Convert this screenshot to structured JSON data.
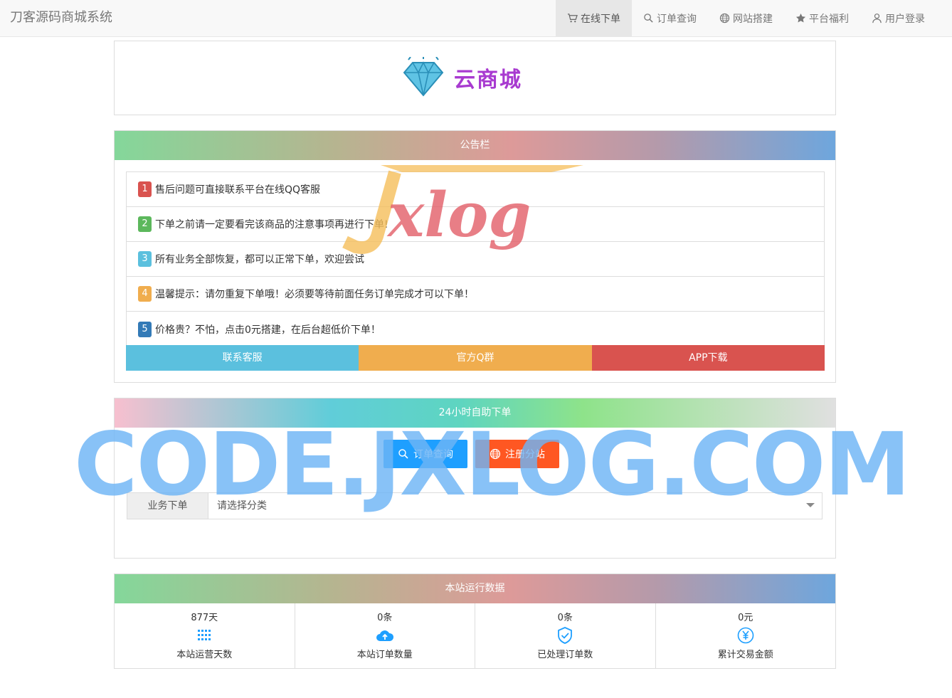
{
  "navbar": {
    "brand": "刀客源码商城系统",
    "items": [
      {
        "label": "在线下单",
        "icon": "cart-icon",
        "active": true
      },
      {
        "label": "订单查询",
        "icon": "search-icon"
      },
      {
        "label": "网站搭建",
        "icon": "globe-icon"
      },
      {
        "label": "平台福利",
        "icon": "star-icon"
      },
      {
        "label": "用户登录",
        "icon": "user-icon"
      }
    ]
  },
  "logo": {
    "text": "云商城",
    "icon": "diamond-icon"
  },
  "notice": {
    "title": "公告栏",
    "items": [
      {
        "num": "1",
        "text": "售后问题可直接联系平台在线QQ客服",
        "color": "#d9534f"
      },
      {
        "num": "2",
        "text": "下单之前请一定要看完该商品的注意事项再进行下单!",
        "color": "#5cb85c"
      },
      {
        "num": "3",
        "text": "所有业务全部恢复，都可以正常下单，欢迎尝试",
        "color": "#5bc0de"
      },
      {
        "num": "4",
        "text": "温馨提示：请勿重复下单哦！必须要等待前面任务订单完成才可以下单！",
        "color": "#f0ad4e"
      },
      {
        "num": "5",
        "text": "价格贵？不怕，点击0元搭建，在后台超低价下单！",
        "color": "#337ab7"
      }
    ],
    "buttons": [
      {
        "label": "联系客服",
        "color": "#5bc0de"
      },
      {
        "label": "官方Q群",
        "color": "#f0ad4e"
      },
      {
        "label": "APP下载",
        "color": "#d9534f"
      }
    ]
  },
  "order": {
    "title": "24小时自助下单",
    "query_button": "订单查询",
    "register_button": "注册分站",
    "label": "业务下单",
    "select_value": "请选择分类"
  },
  "stats": {
    "title": "本站运行数据",
    "items": [
      {
        "value": "877天",
        "label": "本站运营天数",
        "icon": "grid-icon"
      },
      {
        "value": "0条",
        "label": "本站订单数量",
        "icon": "cloud-upload-icon"
      },
      {
        "value": "0条",
        "label": "已处理订单数",
        "icon": "shield-check-icon"
      },
      {
        "value": "0元",
        "label": "累计交易金额",
        "icon": "yen-icon"
      }
    ]
  },
  "watermarks": {
    "logo_text": "Jxlog",
    "domain_text": "CODE.JXLOG.COM"
  }
}
